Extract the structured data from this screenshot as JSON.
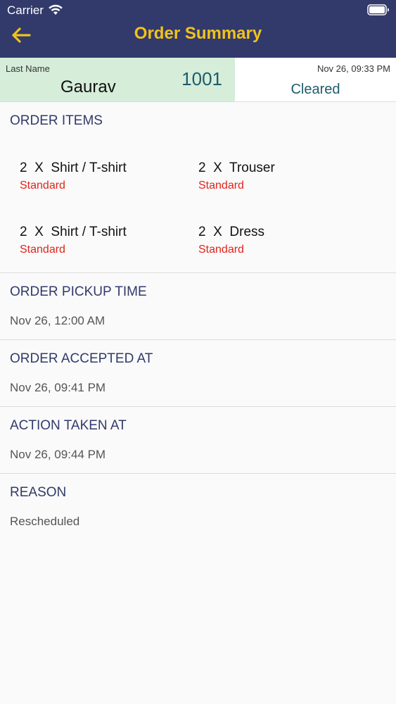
{
  "status_bar": {
    "carrier": "Carrier"
  },
  "header": {
    "title": "Order Summary"
  },
  "order_info": {
    "last_name_label": "Last Name",
    "last_name": "Gaurav",
    "order_number": "1001",
    "datetime": "Nov 26, 09:33 PM",
    "status": "Cleared"
  },
  "order_items": {
    "title": "ORDER ITEMS",
    "items": [
      {
        "qty": "2",
        "sep": "X",
        "name": "Shirt / T-shirt",
        "service": "Standard"
      },
      {
        "qty": "2",
        "sep": "X",
        "name": "Trouser",
        "service": "Standard"
      },
      {
        "qty": "2",
        "sep": "X",
        "name": "Shirt / T-shirt",
        "service": "Standard"
      },
      {
        "qty": "2",
        "sep": "X",
        "name": "Dress",
        "service": "Standard"
      }
    ]
  },
  "pickup": {
    "title": "ORDER PICKUP TIME",
    "value": "Nov 26, 12:00 AM"
  },
  "accepted": {
    "title": "ORDER ACCEPTED AT",
    "value": "Nov 26, 09:41 PM"
  },
  "action": {
    "title": "ACTION TAKEN AT",
    "value": "Nov 26, 09:44 PM"
  },
  "reason": {
    "title": "REASON",
    "value": "Rescheduled"
  },
  "colors": {
    "header_bg": "#323a6b",
    "title_accent": "#f2c21a",
    "name_panel_bg": "#d5edd9",
    "status_teal": "#1d5c6b",
    "service_red": "#e0241b"
  }
}
